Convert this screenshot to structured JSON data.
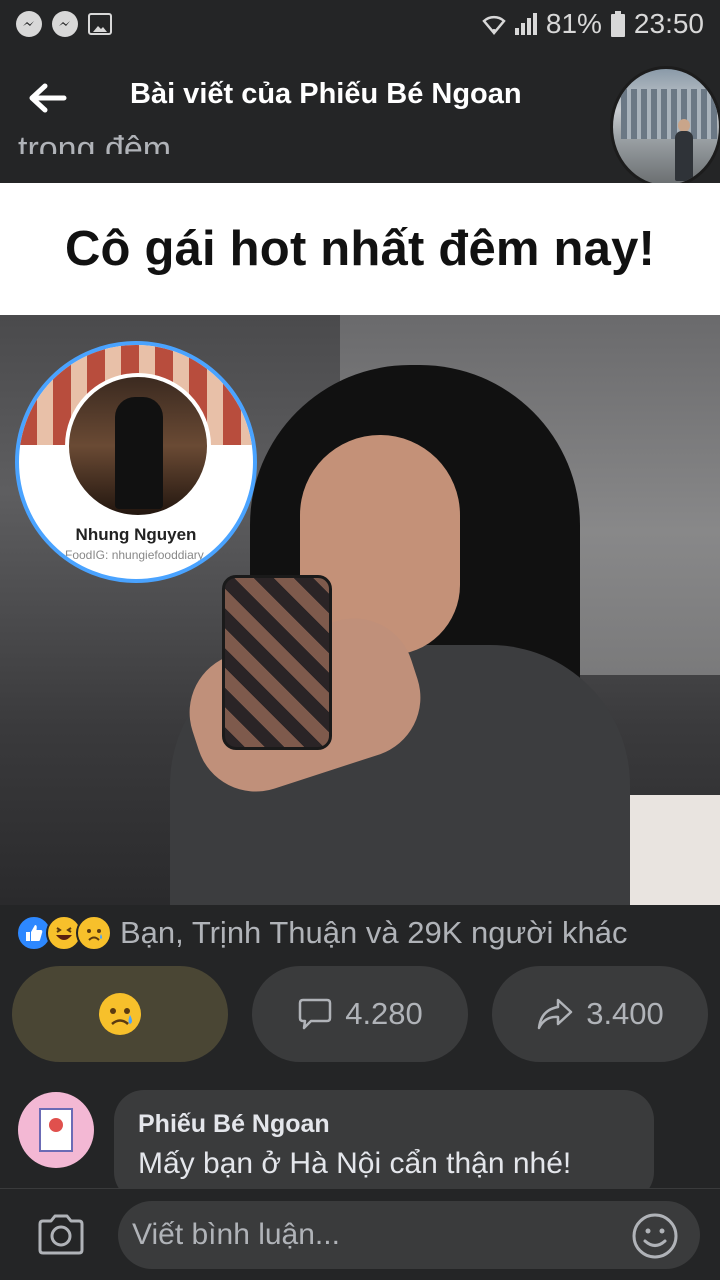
{
  "status_bar": {
    "battery": "81%",
    "time": "23:50"
  },
  "app_bar": {
    "title": "Bài viết của Phiếu Bé Ngoan",
    "ghost_text": "trong đêm."
  },
  "post": {
    "meme_caption": "Cô gái hot nhất đêm nay!",
    "profile_bubble": {
      "name": "Nhung Nguyen",
      "sub": "FoodIG: nhungiefooddiary"
    }
  },
  "reactions": {
    "summary": "Bạn, Trịnh Thuận và 29K người khác"
  },
  "actions": {
    "comments_count": "4.280",
    "shares_count": "3.400"
  },
  "comment": {
    "author": "Phiếu Bé Ngoan",
    "text": "Mấy bạn ở Hà Nội cẩn thận nhé!"
  },
  "composer": {
    "placeholder": "Viết bình luận..."
  },
  "colors": {
    "background": "#242526",
    "surface": "#3a3b3c",
    "like_blue": "#2d88ff",
    "reaction_yellow": "#f7c02b",
    "active_react_bg": "#4a4634"
  },
  "icons": [
    "messenger-icon",
    "image-icon",
    "wifi-icon",
    "signal-icon",
    "battery-icon",
    "back-arrow-icon",
    "like-icon",
    "haha-icon",
    "sad-icon",
    "comment-icon",
    "share-icon",
    "camera-icon",
    "emoji-icon"
  ]
}
